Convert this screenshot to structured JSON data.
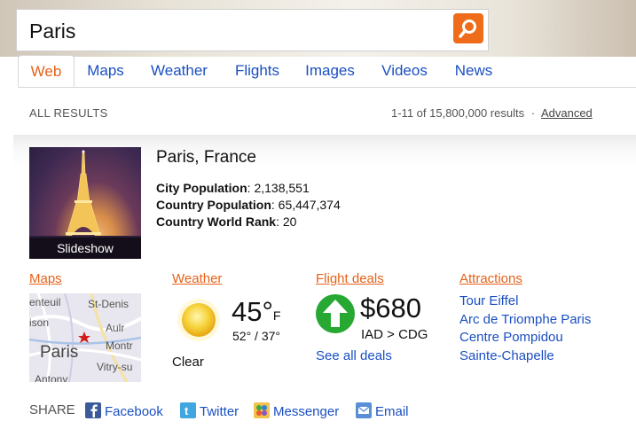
{
  "search": {
    "value": "Paris"
  },
  "tabs": [
    "Web",
    "Maps",
    "Weather",
    "Flights",
    "Images",
    "Videos",
    "News"
  ],
  "results": {
    "label": "ALL RESULTS",
    "count": "1-11 of 15,800,000 results",
    "separator": "·",
    "advanced": "Advanced"
  },
  "entity": {
    "photo_caption": "Slideshow",
    "title": "Paris, France",
    "facts": [
      {
        "label": "City Population",
        "value": ": 2,138,551"
      },
      {
        "label": "Country Population",
        "value": ": 65,447,374"
      },
      {
        "label": "Country World Rank",
        "value": ": 20"
      }
    ]
  },
  "maps": {
    "title": "Maps",
    "labels": [
      "enteuil",
      "St-Denis",
      "ison",
      "Aulr",
      "Montr",
      "Paris",
      "Vitry-su",
      "Antony"
    ]
  },
  "weather": {
    "title": "Weather",
    "temp": "45°",
    "unit": "F",
    "range": "52° / 37°",
    "condition": "Clear"
  },
  "flights": {
    "title": "Flight deals",
    "price": "$680",
    "route": "IAD > CDG",
    "see_all": "See all deals"
  },
  "attractions": {
    "title": "Attractions",
    "items": [
      "Tour Eiffel",
      "Arc de Triomphe Paris",
      "Centre Pompidou",
      "Sainte-Chapelle"
    ]
  },
  "share": {
    "label": "SHARE",
    "items": [
      "Facebook",
      "Twitter",
      "Messenger",
      "Email"
    ]
  },
  "icons": {
    "search": "magnifier-icon",
    "weather": "sun-icon",
    "flight": "up-arrow-icon",
    "facebook": "facebook-icon",
    "twitter": "twitter-icon",
    "messenger": "messenger-icon",
    "email": "email-icon"
  },
  "colors": {
    "accent_orange": "#e4621a",
    "link_blue": "#1a4fc2",
    "search_button": "#ef6c1b",
    "flight_green": "#27a833"
  }
}
